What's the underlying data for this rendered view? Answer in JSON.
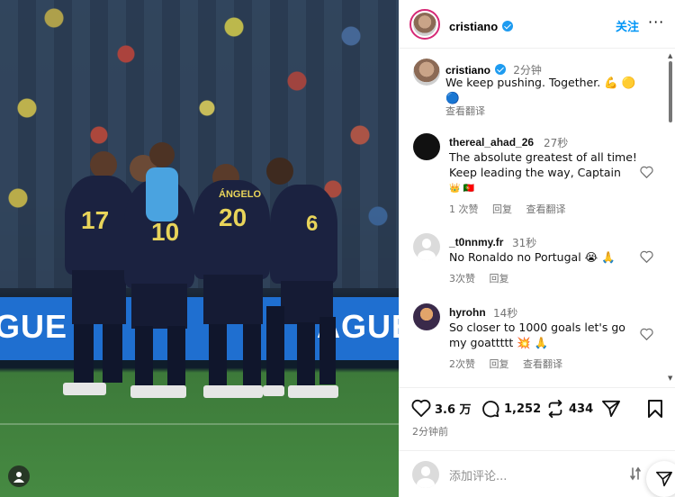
{
  "header": {
    "username": "cristiano",
    "follow_label": "关注",
    "more_label": "···"
  },
  "caption": {
    "username": "cristiano",
    "time": "2分钟",
    "text": "We keep pushing. Together. 💪 🟡",
    "text_line2": "🔵",
    "translate_label": "查看翻译"
  },
  "comments": [
    {
      "username": "thereal_ahad_26",
      "time": "27秒",
      "lines": [
        "The absolute greatest of all time!",
        "Keep leading the way, Captain",
        "👑 🇵🇹"
      ],
      "likes": "1 次赞",
      "reply": "回复",
      "translate": "查看翻译"
    },
    {
      "username": "_t0nnmy.fr",
      "time": "31秒",
      "lines": [
        "No Ronaldo no Portugal 😭 🙏"
      ],
      "likes": "3次赞",
      "reply": "回复",
      "translate": ""
    },
    {
      "username": "hyrohn",
      "time": "14秒",
      "lines": [
        "So closer to 1000 goals let's go",
        "my goattttt 💥 🙏"
      ],
      "likes": "2次赞",
      "reply": "回复",
      "translate": "查看翻译"
    }
  ],
  "actions": {
    "likes": "3.6 万",
    "comments": "1,252",
    "reposts": "434",
    "post_time": "2分钟前"
  },
  "comment_bar": {
    "placeholder": "添加评论..."
  },
  "photo": {
    "banner_left": "GUE",
    "banner_right": "AGUE",
    "jersey_numbers": [
      "17",
      "10",
      "20",
      "6"
    ],
    "jersey_name": "ÁNGELO"
  },
  "colors": {
    "accent": "#0095f6",
    "verified": "#1d9bf0",
    "meta": "#737373"
  }
}
